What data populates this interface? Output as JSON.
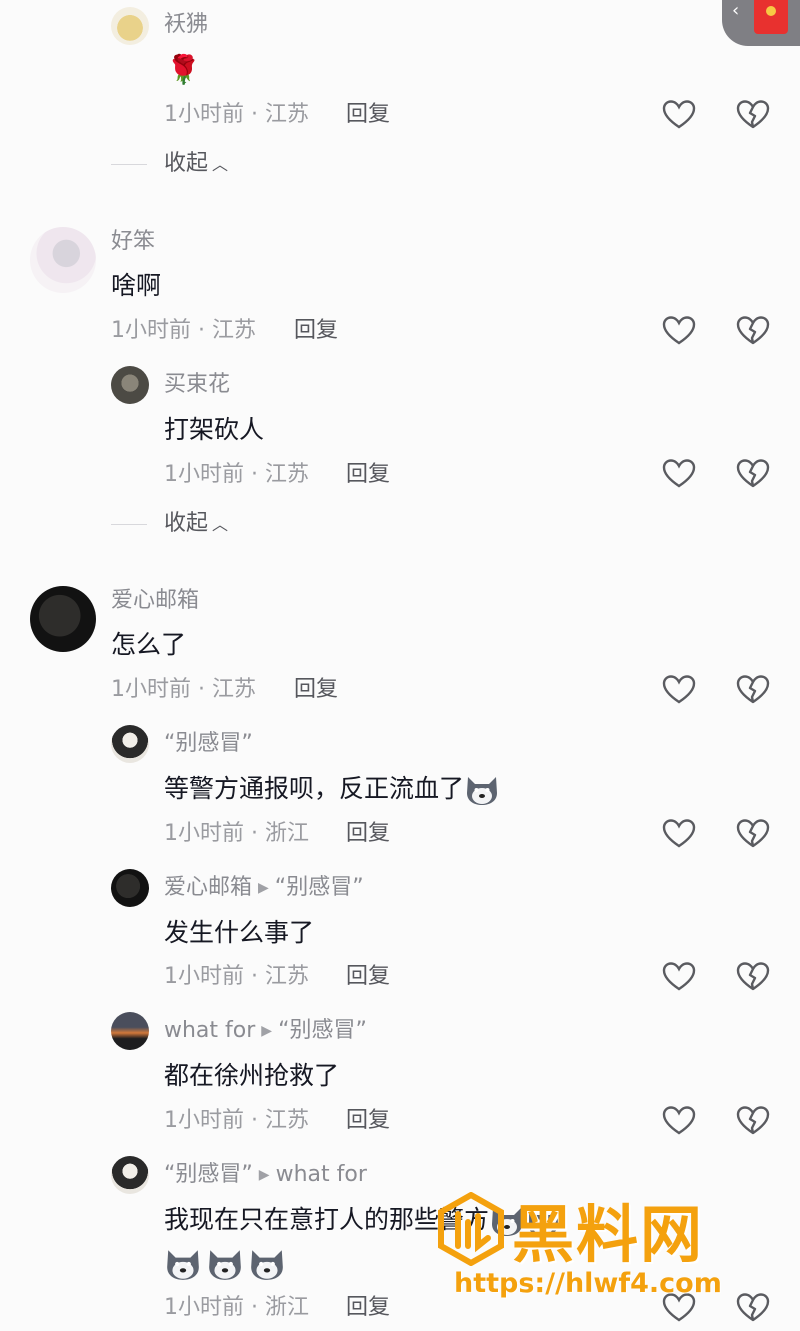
{
  "reply_1": {
    "username": "袄狒",
    "text": "🌹",
    "meta": "1小时前 · 江苏",
    "reply": "回复"
  },
  "collapse_1": {
    "label": "收起"
  },
  "comment_1": {
    "username": "好笨",
    "text": "啥啊",
    "meta": "1小时前 · 江苏",
    "reply": "回复"
  },
  "reply_2": {
    "username": "买束花",
    "text": "打架砍人",
    "meta": "1小时前 · 江苏",
    "reply": "回复"
  },
  "collapse_2": {
    "label": "收起"
  },
  "comment_2": {
    "username": "爱心邮箱",
    "text": "怎么了",
    "meta": "1小时前 · 江苏",
    "reply": "回复"
  },
  "reply_3": {
    "username": "“别感冒”",
    "text": "等警方通报呗，反正流血了",
    "meta": "1小时前 · 浙江",
    "reply": "回复"
  },
  "reply_4": {
    "username": "爱心邮箱",
    "to": "“别感冒”",
    "text": "发生什么事了",
    "meta": "1小时前 · 江苏",
    "reply": "回复"
  },
  "reply_5": {
    "username": "what for",
    "to": "“别感冒”",
    "text": "都在徐州抢救了",
    "meta": "1小时前 · 江苏",
    "reply": "回复"
  },
  "reply_6": {
    "username": "“别感冒”",
    "to": "what for",
    "text": "我现在只在意打人的那些警方",
    "meta": "1小时前 · 浙江",
    "reply": "回复"
  },
  "watermark": {
    "brand": "黑料网",
    "url": "https://hlwf4.com"
  },
  "colors": {
    "accent": "#f4a10e",
    "red_packet": "#e8312f"
  }
}
